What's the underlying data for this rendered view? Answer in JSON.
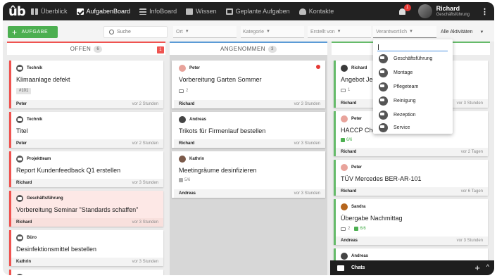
{
  "app": {
    "logo": "ûb"
  },
  "nav": [
    {
      "label": "Überblick",
      "icon": "dashboard-icon",
      "active": false
    },
    {
      "label": "AufgabenBoard",
      "icon": "checkbox-icon",
      "active": true
    },
    {
      "label": "InfoBoard",
      "icon": "list-icon",
      "active": false
    },
    {
      "label": "Wissen",
      "icon": "book-icon",
      "active": false
    },
    {
      "label": "Geplante Aufgaben",
      "icon": "calendar-icon",
      "active": false
    },
    {
      "label": "Kontakte",
      "icon": "person-icon",
      "active": false
    }
  ],
  "notifications": {
    "count": "1"
  },
  "user": {
    "name": "Richard",
    "role": "Geschäftsführung",
    "menu_icon": "⋮"
  },
  "toolbar": {
    "add_label": "AUFGABE",
    "add_icon": "+",
    "search_placeholder": "Suche",
    "filters": {
      "ort": "Ort",
      "kategorie": "Kategorie",
      "erstellt_von": "Erstellt von",
      "verantwortlich": "Verantwortlich",
      "aktivitaeten": "Alle Aktivitäten"
    }
  },
  "columns": [
    {
      "title": "OFFEN",
      "count": "6",
      "alert": "1",
      "accent": "#ef5350",
      "cards": [
        {
          "category": "Technik",
          "title": "Klimaanlage defekt",
          "tag": "#101",
          "assignee": "Peter",
          "time": "vor 2 Stunden",
          "alt": false
        },
        {
          "category": "Technik",
          "title": "Titel",
          "assignee": "Peter",
          "time": "vor 2 Stunden",
          "alt": false
        },
        {
          "category": "Projektteam",
          "title": "Report Kundenfeedback Q1 erstellen",
          "assignee": "Richard",
          "time": "vor 3 Stunden",
          "alt": false
        },
        {
          "category": "Geschäftsführung",
          "title": "Vorbereitung Seminar \"Standards schaffen\"",
          "assignee": "Richard",
          "time": "vor 3 Stunden",
          "alt": true
        },
        {
          "category": "Büro",
          "title": "Desinfektionsmittel bestellen",
          "assignee": "Kathrin",
          "time": "vor 3 Stunden",
          "alt": false
        }
      ]
    },
    {
      "title": "ANGENOMMEN",
      "count": "3",
      "accent": "#5c9bd6",
      "cards": [
        {
          "author": "Peter",
          "title": "Vorbereitung Garten Sommer",
          "comments": "2",
          "assignee": "Richard",
          "time": "vor 3 Stunden",
          "flag": true
        },
        {
          "author": "Andreas",
          "title": "Trikots für Firmenlauf bestellen",
          "assignee": "Richard",
          "time": "vor 3 Stunden"
        },
        {
          "author": "Kathrin",
          "title": "Meetingräume desinfizieren",
          "checklist": "5/6",
          "assignee": "Andreas",
          "time": "vor 3 Stunden"
        }
      ]
    },
    {
      "title": "",
      "accent": "#66bb6a",
      "cards": [
        {
          "author": "Richard",
          "title": "Angebot Jer",
          "comments": "1",
          "assignee": "Richard",
          "time": "vor 3 Stunden"
        },
        {
          "author": "Peter",
          "title": "HACCP Chec",
          "checklist": "6/6",
          "assignee": "Richard",
          "time": "vor 2 Tagen"
        },
        {
          "author": "Peter",
          "title": "TÜV Mercedes BER-AR-101",
          "assignee": "Richard",
          "time": "vor 6 Tagen"
        },
        {
          "author": "Sandra",
          "title": "Übergabe Nachmittag",
          "comments": "2",
          "checklist": "6/6",
          "assignee": "Andreas",
          "time": "vor 3 Stunden"
        },
        {
          "author": "Andreas"
        }
      ]
    }
  ],
  "dropdown": {
    "search_value": "",
    "options": [
      "Geschäftsführung",
      "Montage",
      "Pflegeteam",
      "Reinigung",
      "Rezeption",
      "Service"
    ]
  },
  "chat": {
    "label": "Chats",
    "add_icon": "+",
    "collapse_icon": "^"
  }
}
